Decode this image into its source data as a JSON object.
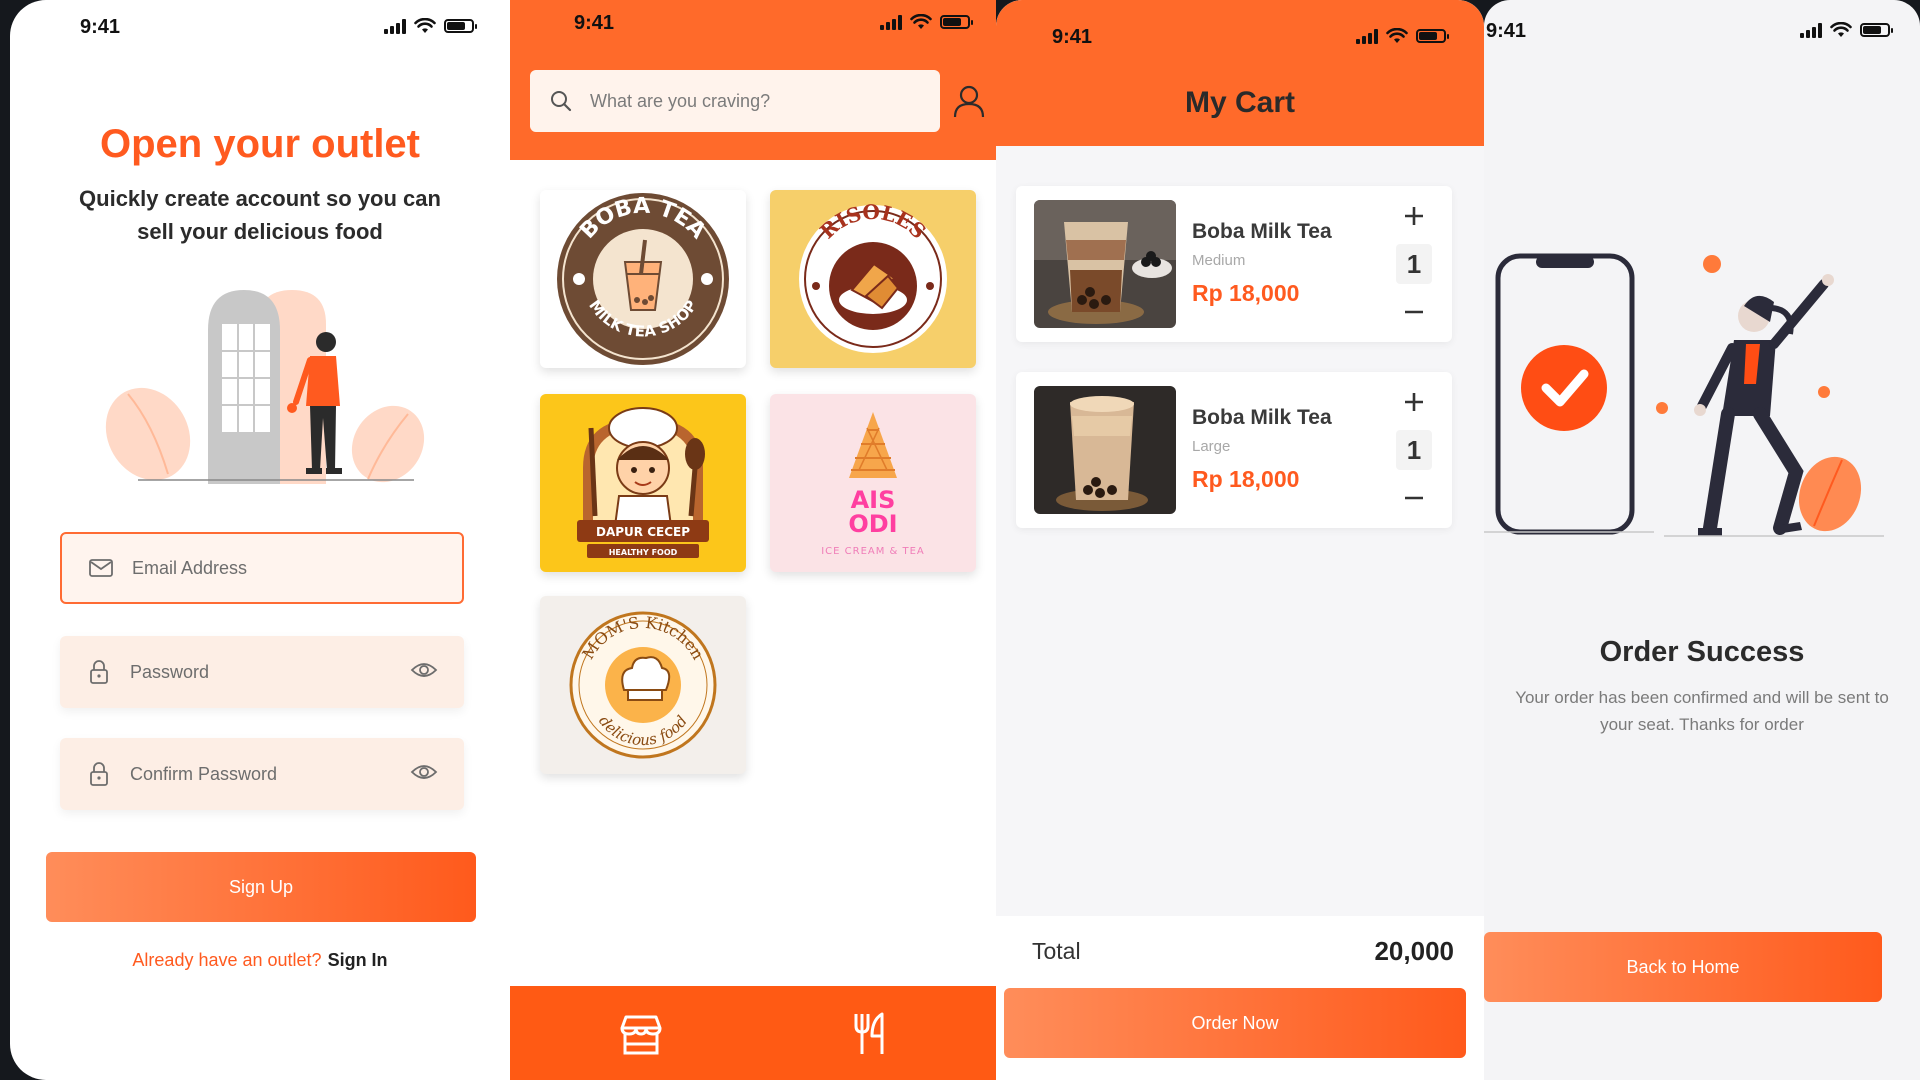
{
  "status_time": "9:41",
  "signup": {
    "title": "Open your outlet",
    "subtitle": "Quickly create account so you can sell your delicious food",
    "email_placeholder": "Email Address",
    "password_placeholder": "Password",
    "confirm_placeholder": "Confirm Password",
    "signup_button": "Sign Up",
    "footer_question": "Already have an outlet?",
    "footer_link": "Sign In"
  },
  "home": {
    "search_placeholder": "What are you craving?",
    "outlets": [
      {
        "name": "Boba Tea Milk Tea Shop",
        "logo_top": "BOBA TEA",
        "logo_bottom": "MILK TEA SHOP"
      },
      {
        "name": "Risoles",
        "logo_top": "RISOLES"
      },
      {
        "name": "Dapur Cecep",
        "logo_top": "DAPUR CECEP",
        "logo_bottom": "HEALTHY FOOD"
      },
      {
        "name": "Ais Odi",
        "logo_top": "AIS",
        "logo_mid": "ODI",
        "logo_bottom": "ICE CREAM & TEA"
      },
      {
        "name": "Mom's Kitchen",
        "logo_top": "MOM'S Kitchen",
        "logo_bottom": "delicious food"
      }
    ],
    "tabs": [
      {
        "icon": "store-icon"
      },
      {
        "icon": "fork-knife-icon"
      }
    ]
  },
  "cart": {
    "title": "My Cart",
    "items": [
      {
        "name": "Boba Milk Tea",
        "size": "Medium",
        "price": "Rp 18,000",
        "qty": "1"
      },
      {
        "name": "Boba Milk Tea",
        "size": "Large",
        "price": "Rp 18,000",
        "qty": "1"
      }
    ],
    "total_label": "Total",
    "total_value": "20,000",
    "order_button": "Order Now"
  },
  "success": {
    "title": "Order Success",
    "message": "Your order has been confirmed and will be sent to your seat. Thanks for order",
    "button": "Back to Home"
  },
  "colors": {
    "accent": "#ff5a1f",
    "header": "#ff6a2a"
  }
}
